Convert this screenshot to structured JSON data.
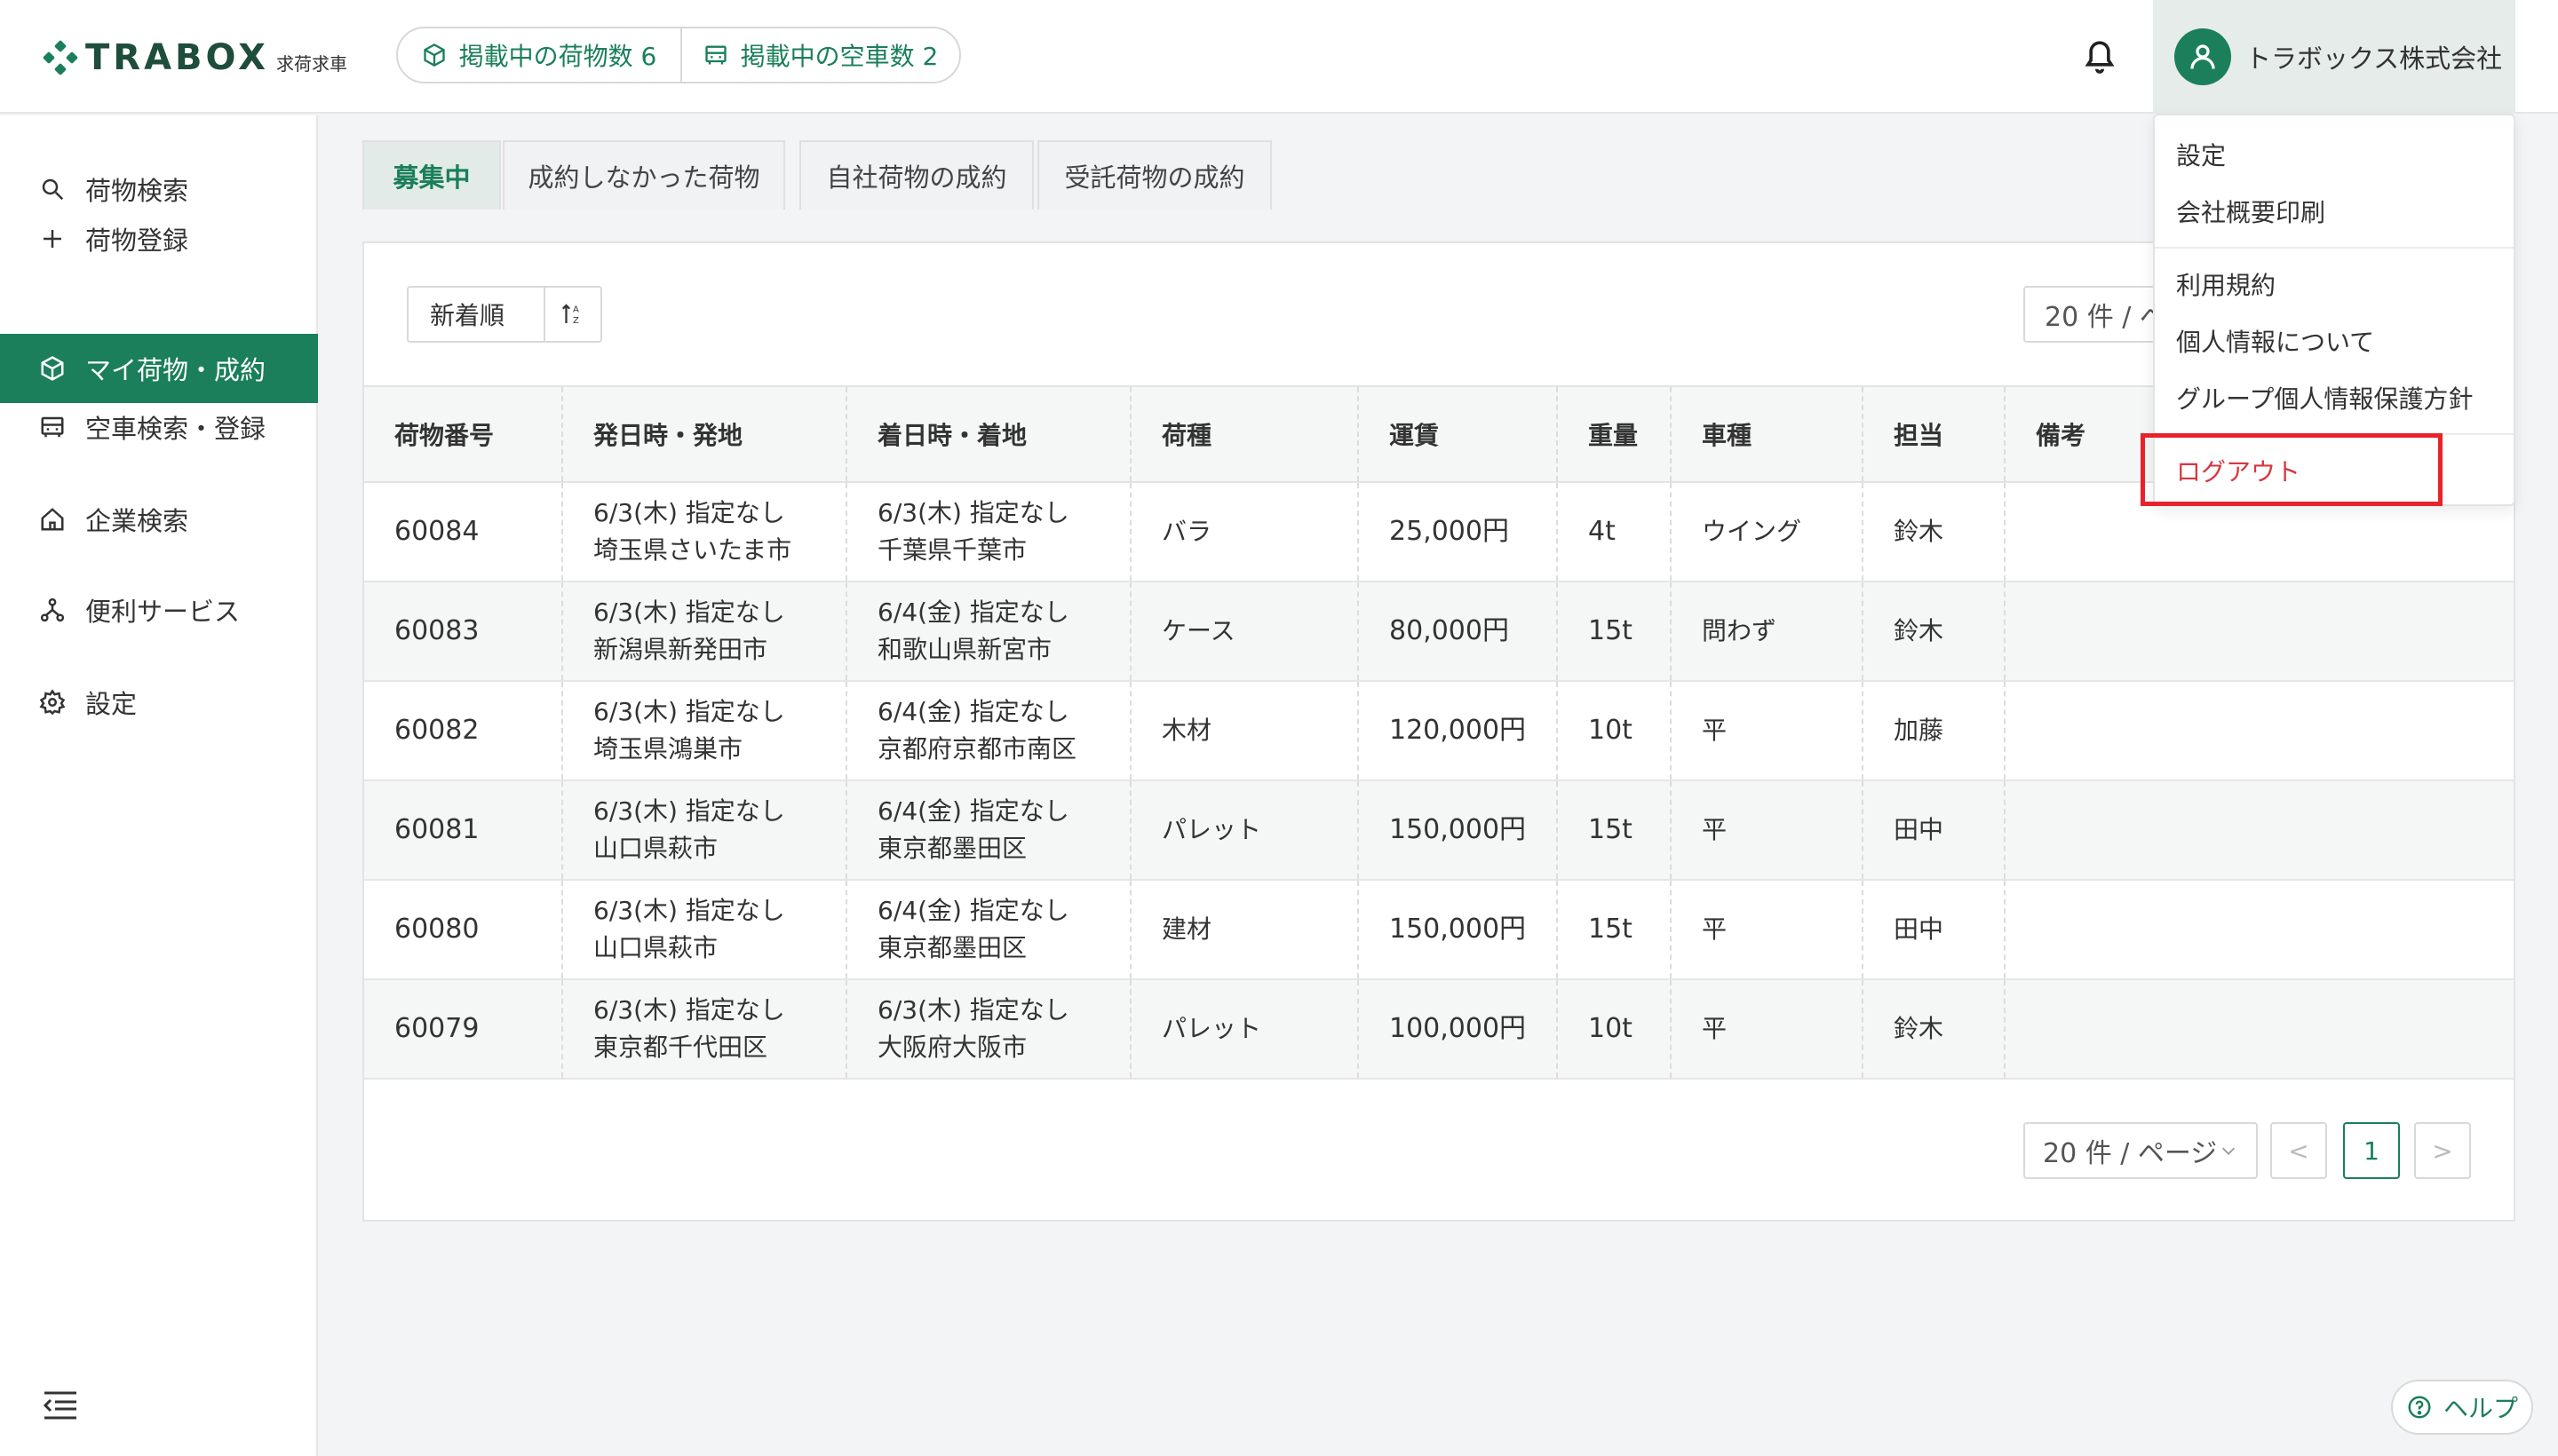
{
  "app": {
    "logo_text": "TRABOX",
    "logo_sub": "求荷求車",
    "brand_color": "#1a7f5a"
  },
  "header": {
    "cargo_count_label": "掲載中の荷物数 6",
    "vehicle_count_label": "掲載中の空車数 2",
    "user_name": "トラボックス株式会社"
  },
  "sidebar": {
    "items": [
      {
        "label": "荷物検索",
        "icon": "search-icon"
      },
      {
        "label": "荷物登録",
        "icon": "plus-icon"
      },
      {
        "label": "マイ荷物・成約",
        "icon": "box-icon"
      },
      {
        "label": "空車検索・登録",
        "icon": "truck-icon"
      },
      {
        "label": "企業検索",
        "icon": "home-icon"
      },
      {
        "label": "便利サービス",
        "icon": "network-icon"
      },
      {
        "label": "設定",
        "icon": "gear-icon"
      }
    ],
    "active_index": 2
  },
  "tabs": [
    {
      "label": "募集中"
    },
    {
      "label": "成約しなかった荷物"
    },
    {
      "label": "自社荷物の成約"
    },
    {
      "label": "受託荷物の成約"
    }
  ],
  "toolbar": {
    "sort_label": "新着順",
    "per_page_top": "20 件 / ペ"
  },
  "table": {
    "headers": [
      "荷物番号",
      "発日時・発地",
      "着日時・着地",
      "荷種",
      "運賃",
      "重量",
      "車種",
      "担当",
      "備考"
    ],
    "rows": [
      {
        "id": "60084",
        "dep_date": "6/3(木) 指定なし",
        "dep_place": "埼玉県さいたま市",
        "arr_date": "6/3(木) 指定なし",
        "arr_place": "千葉県千葉市",
        "cargo": "バラ",
        "fare": "25,000円",
        "weight": "4t",
        "vehicle": "ウイング",
        "staff": "鈴木",
        "note": ""
      },
      {
        "id": "60083",
        "dep_date": "6/3(木) 指定なし",
        "dep_place": "新潟県新発田市",
        "arr_date": "6/4(金) 指定なし",
        "arr_place": "和歌山県新宮市",
        "cargo": "ケース",
        "fare": "80,000円",
        "weight": "15t",
        "vehicle": "問わず",
        "staff": "鈴木",
        "note": ""
      },
      {
        "id": "60082",
        "dep_date": "6/3(木) 指定なし",
        "dep_place": "埼玉県鴻巣市",
        "arr_date": "6/4(金) 指定なし",
        "arr_place": "京都府京都市南区",
        "cargo": "木材",
        "fare": "120,000円",
        "weight": "10t",
        "vehicle": "平",
        "staff": "加藤",
        "note": ""
      },
      {
        "id": "60081",
        "dep_date": "6/3(木) 指定なし",
        "dep_place": "山口県萩市",
        "arr_date": "6/4(金) 指定なし",
        "arr_place": "東京都墨田区",
        "cargo": "パレット",
        "fare": "150,000円",
        "weight": "15t",
        "vehicle": "平",
        "staff": "田中",
        "note": ""
      },
      {
        "id": "60080",
        "dep_date": "6/3(木) 指定なし",
        "dep_place": "山口県萩市",
        "arr_date": "6/4(金) 指定なし",
        "arr_place": "東京都墨田区",
        "cargo": "建材",
        "fare": "150,000円",
        "weight": "15t",
        "vehicle": "平",
        "staff": "田中",
        "note": ""
      },
      {
        "id": "60079",
        "dep_date": "6/3(木) 指定なし",
        "dep_place": "東京都千代田区",
        "arr_date": "6/3(木) 指定なし",
        "arr_place": "大阪府大阪市",
        "cargo": "パレット",
        "fare": "100,000円",
        "weight": "10t",
        "vehicle": "平",
        "staff": "鈴木",
        "note": ""
      }
    ]
  },
  "pagination": {
    "per_page": "20 件 / ページ",
    "prev": "<",
    "current": "1",
    "next": ">"
  },
  "dropdown": {
    "settings": "設定",
    "company_print": "会社概要印刷",
    "terms": "利用規約",
    "privacy": "個人情報について",
    "group_privacy": "グループ個人情報保護方針",
    "logout": "ログアウト"
  },
  "help": {
    "label": "ヘルプ"
  }
}
